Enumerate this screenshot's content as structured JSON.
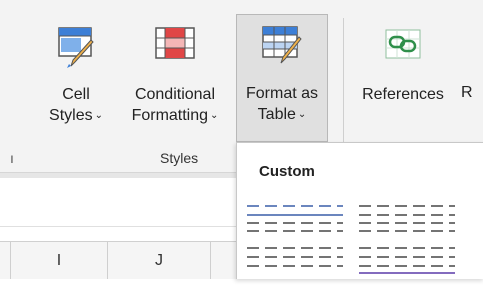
{
  "ribbon": {
    "buttons": [
      {
        "id": "cell-styles",
        "line1": "Cell",
        "line2": "Styles",
        "chevron": "⌄"
      },
      {
        "id": "conditional-formatting",
        "line1": "Conditional",
        "line2": "Formatting",
        "chevron": "⌄"
      },
      {
        "id": "format-as-table",
        "line1": "Format as",
        "line2": "Table",
        "chevron": "⌄"
      },
      {
        "id": "references",
        "line1": "References",
        "line2": "",
        "chevron": ""
      }
    ],
    "truncated_next_label": "R",
    "group_label": "Styles",
    "left_edge_mark": "ı"
  },
  "sheet": {
    "columns": [
      "I",
      "J"
    ]
  },
  "dropdown": {
    "section_title": "Custom",
    "styles": [
      {
        "name": "custom-table-style-1",
        "accent": "#3a5fa8"
      },
      {
        "name": "custom-table-style-2",
        "accent": "#222222"
      },
      {
        "name": "custom-table-style-3",
        "accent": "#222222"
      },
      {
        "name": "custom-table-style-4",
        "accent": "#5a3aa8"
      }
    ]
  },
  "colors": {
    "ribbon_bg": "#f3f3f3",
    "active_button_bg": "#e0e0e0",
    "icon_blue": "#3d7fd6",
    "icon_red": "#e04646",
    "references_green": "#2f8f4a"
  }
}
